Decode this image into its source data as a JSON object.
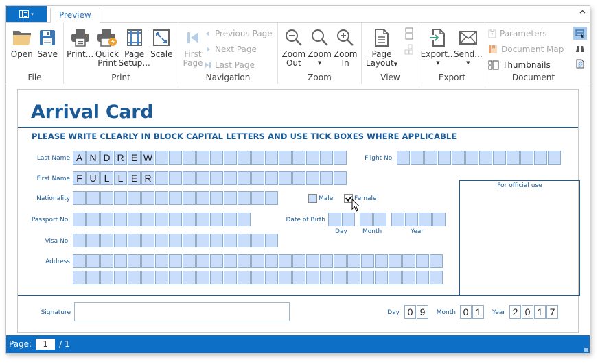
{
  "ribbon": {
    "app_button_caret": "▾",
    "tab": "Preview",
    "collapse_icon": "^",
    "groups": {
      "file": {
        "label": "File",
        "open": "Open",
        "save": "Save"
      },
      "print": {
        "label": "Print",
        "print": "Print...",
        "quick_print_1": "Quick",
        "quick_print_2": "Print",
        "page_setup_1": "Page",
        "page_setup_2": "Setup...",
        "scale": "Scale"
      },
      "navigation": {
        "label": "Navigation",
        "first_page_1": "First",
        "first_page_2": "Page",
        "previous_page": "Previous Page",
        "next_page": "Next Page",
        "last_page": "Last Page"
      },
      "zoom": {
        "label": "Zoom",
        "zoom_out_1": "Zoom",
        "zoom_out_2": "Out",
        "zoom": "Zoom",
        "zoom_in_1": "Zoom",
        "zoom_in_2": "In"
      },
      "view": {
        "label": "View",
        "page_layout_1": "Page",
        "page_layout_2": "Layout"
      },
      "export": {
        "label": "Export",
        "export": "Export...",
        "send": "Send..."
      },
      "document": {
        "label": "Document",
        "parameters": "Parameters",
        "document_map": "Document Map",
        "thumbnails": "Thumbnails"
      }
    }
  },
  "form": {
    "title": "Arrival Card",
    "instructions": "PLEASE WRITE CLEARLY IN BLOCK CAPITAL LETTERS AND USE TICK BOXES WHERE APPLICABLE",
    "fields": {
      "last_name": {
        "label": "Last Name",
        "value": [
          "A",
          "N",
          "D",
          "R",
          "E",
          "W",
          "",
          "",
          "",
          "",
          "",
          "",
          "",
          "",
          "",
          "",
          "",
          "",
          "",
          ""
        ]
      },
      "first_name": {
        "label": "First Name",
        "value": [
          "F",
          "U",
          "L",
          "L",
          "E",
          "R",
          "",
          "",
          "",
          "",
          "",
          "",
          "",
          "",
          "",
          "",
          "",
          "",
          "",
          ""
        ]
      },
      "nationality": {
        "label": "Nationality",
        "value": [
          "",
          "",
          "",
          "",
          "",
          "",
          "",
          "",
          "",
          "",
          "",
          "",
          "",
          "",
          ""
        ]
      },
      "passport_no": {
        "label": "Passport No.",
        "value": [
          "",
          "",
          "",
          "",
          "",
          "",
          "",
          "",
          "",
          "",
          "",
          "",
          ""
        ]
      },
      "visa_no": {
        "label": "Visa No.",
        "value": [
          "",
          "",
          "",
          "",
          "",
          "",
          "",
          "",
          "",
          "",
          "",
          "",
          "",
          "",
          ""
        ]
      },
      "address_line1": {
        "label": "Address",
        "value": [
          "",
          "",
          "",
          "",
          "",
          "",
          "",
          "",
          "",
          "",
          "",
          "",
          "",
          "",
          "",
          "",
          "",
          "",
          "",
          "",
          "",
          "",
          "",
          "",
          "",
          "",
          ""
        ]
      },
      "address_line2": {
        "value": [
          "",
          "",
          "",
          "",
          "",
          "",
          "",
          "",
          "",
          "",
          "",
          "",
          "",
          "",
          "",
          "",
          "",
          "",
          "",
          "",
          "",
          "",
          "",
          "",
          "",
          "",
          ""
        ]
      },
      "flight_no": {
        "label": "Flight No.",
        "value": [
          "",
          "",
          "",
          "",
          "",
          "",
          "",
          "",
          "",
          "",
          "",
          ""
        ]
      }
    },
    "gender": {
      "male": {
        "label": "Male",
        "checked": false
      },
      "female": {
        "label": "Female",
        "checked": true
      }
    },
    "date_of_birth": {
      "label": "Date of Birth",
      "day_label": "Day",
      "month_label": "Month",
      "year_label": "Year",
      "day": [
        "",
        ""
      ],
      "month": [
        "",
        ""
      ],
      "year": [
        "",
        "",
        "",
        ""
      ]
    },
    "official_use": "For official use",
    "signature": {
      "label": "Signature",
      "value": ""
    },
    "date": {
      "day_label": "Day",
      "month_label": "Month",
      "year_label": "Year",
      "day": [
        "0",
        "9"
      ],
      "month": [
        "0",
        "1"
      ],
      "year": [
        "2",
        "0",
        "1",
        "7"
      ]
    }
  },
  "status": {
    "page_label": "Page:",
    "current_page": "1",
    "total_pages": "/ 1"
  }
}
